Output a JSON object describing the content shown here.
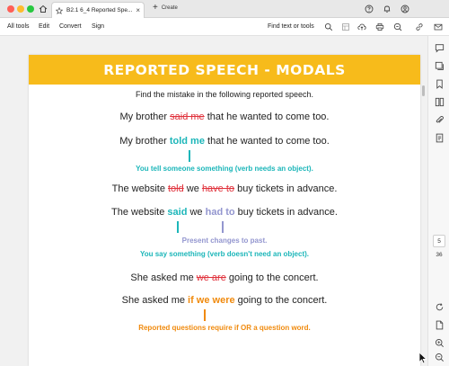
{
  "tabbar": {
    "tab_title": "B2.1 6_4 Reported Spe...",
    "tab_close": "×",
    "create_label": "Create",
    "create_plus": "+"
  },
  "menubar": {
    "items": [
      "All tools",
      "Edit",
      "Convert",
      "Sign"
    ],
    "find_label": "Find text or tools"
  },
  "document": {
    "banner_title": "REPORTED SPEECH - MODALS",
    "instruction": "Find the mistake in the following reported speech.",
    "ex1": {
      "wrong": {
        "a": "My brother ",
        "strike": "said me",
        "b": " that he wanted to come too."
      },
      "right": {
        "a": "My brother ",
        "fix": "told me",
        "b": " that he wanted to come too."
      },
      "note": "You tell someone something (verb needs an object)."
    },
    "ex2": {
      "wrong": {
        "a": "The website ",
        "strike1": "told",
        "b": " we ",
        "strike2": "have to",
        "c": " buy tickets in advance."
      },
      "right": {
        "a": "The website ",
        "fix1": "said",
        "b": " we ",
        "fix2": "had to",
        "c": " buy tickets in advance."
      },
      "note1": "Present changes to past.",
      "note2": "You say something (verb doesn't need an object)."
    },
    "ex3": {
      "wrong": {
        "a": "She asked me ",
        "strike": "we are",
        "b": " going to the concert."
      },
      "right": {
        "a": "She asked me ",
        "fix": "if we were",
        "b": " going to the concert."
      },
      "note": "Reported questions require if OR a question word."
    }
  },
  "rail": {
    "page_current": "5",
    "page_total": "36"
  },
  "colors": {
    "banner": "#f7bb1b",
    "strike": "#e0323c",
    "teal": "#1cb6b9",
    "lilac": "#9396cf",
    "orange": "#f08a0d"
  }
}
